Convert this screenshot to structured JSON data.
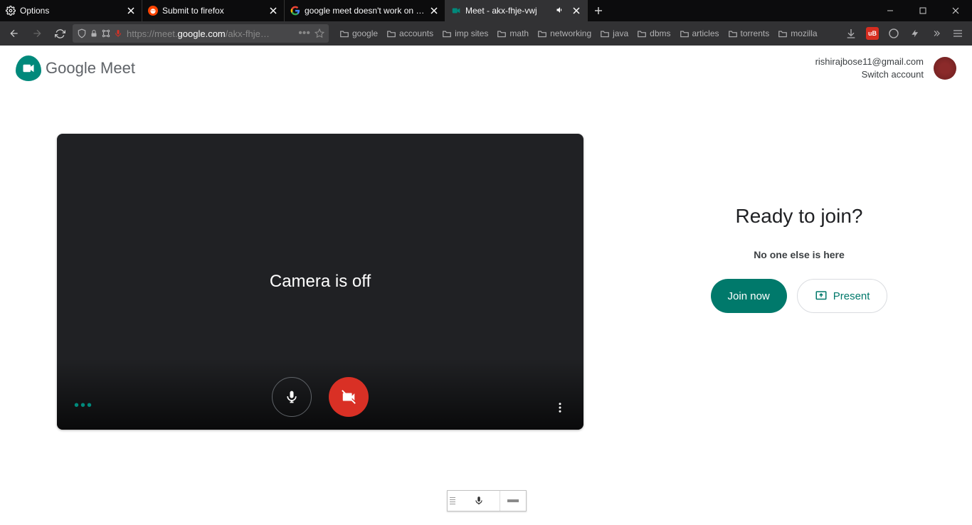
{
  "tabs": [
    {
      "label": "Options",
      "favicon": "gear"
    },
    {
      "label": "Submit to firefox",
      "favicon": "reddit"
    },
    {
      "label": "google meet doesn't work on f…",
      "favicon": "google"
    },
    {
      "label": "Meet - akx-fhje-vwj",
      "favicon": "meet",
      "active": true,
      "audio": true
    }
  ],
  "url": {
    "prefix": "https://meet.",
    "domain": "google.com",
    "suffix": "/akx-fhje…"
  },
  "bookmarks": [
    "google",
    "accounts",
    "imp sites",
    "math",
    "networking",
    "java",
    "dbms",
    "articles",
    "torrents",
    "mozilla"
  ],
  "meet": {
    "logo_text": "Google Meet",
    "email": "rishirajbose11@gmail.com",
    "switch": "Switch account",
    "camera_off": "Camera is off",
    "ready": "Ready to join?",
    "subtext": "No one else is here",
    "join_label": "Join now",
    "present_label": "Present"
  }
}
